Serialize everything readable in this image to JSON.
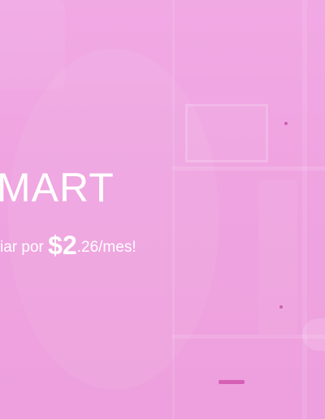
{
  "hero": {
    "headline": "MART",
    "subline_lead": "iar por ",
    "price_main": "$2",
    "price_tail": ".26/mes!"
  },
  "colors": {
    "background": "#efa3e0",
    "text": "#ffffff",
    "accent": "#d660b6"
  }
}
